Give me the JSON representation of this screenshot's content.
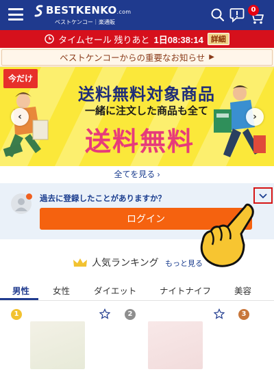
{
  "header": {
    "logo_text": "BESTKENKO",
    "logo_domain": ".com",
    "logo_subtitle": "ベストケンコー｜楽通販",
    "cart_count": "0",
    "bg_color": "#1f3a8e"
  },
  "timesale": {
    "label": "タイムセール 残りあと",
    "countdown": "1日08:38:14",
    "detail_label": "詳細"
  },
  "notice": {
    "text": "ベストケンコーからの重要なお知らせ",
    "arrow": "▶"
  },
  "banner": {
    "badge": "今だけ",
    "line1": "送料無料対象商品",
    "line2": "一緒に注文した商品も全て",
    "line3": "送料無料",
    "prev": "‹",
    "next": "›"
  },
  "see_all": "全てを見る ›",
  "login": {
    "question": "過去に登録したことがありますか？",
    "button": "ログイン",
    "expand_icon": "chevron-down-icon"
  },
  "ranking": {
    "title": "人気ランキング",
    "more": "もっと見る",
    "tabs": [
      "男性",
      "女性",
      "ダイエット",
      "ナイトナイフ",
      "美容"
    ],
    "active_tab": "男性",
    "ranks": [
      "1",
      "2",
      "3"
    ]
  },
  "colors": {
    "brand_navy": "#1f3a8e",
    "sale_red": "#d6101c",
    "login_orange": "#f5620f",
    "banner_yellow": "#fbe83a",
    "rank_gold": "#f2c230",
    "rank_silver": "#8e8e8e",
    "rank_bronze": "#c8763a"
  }
}
